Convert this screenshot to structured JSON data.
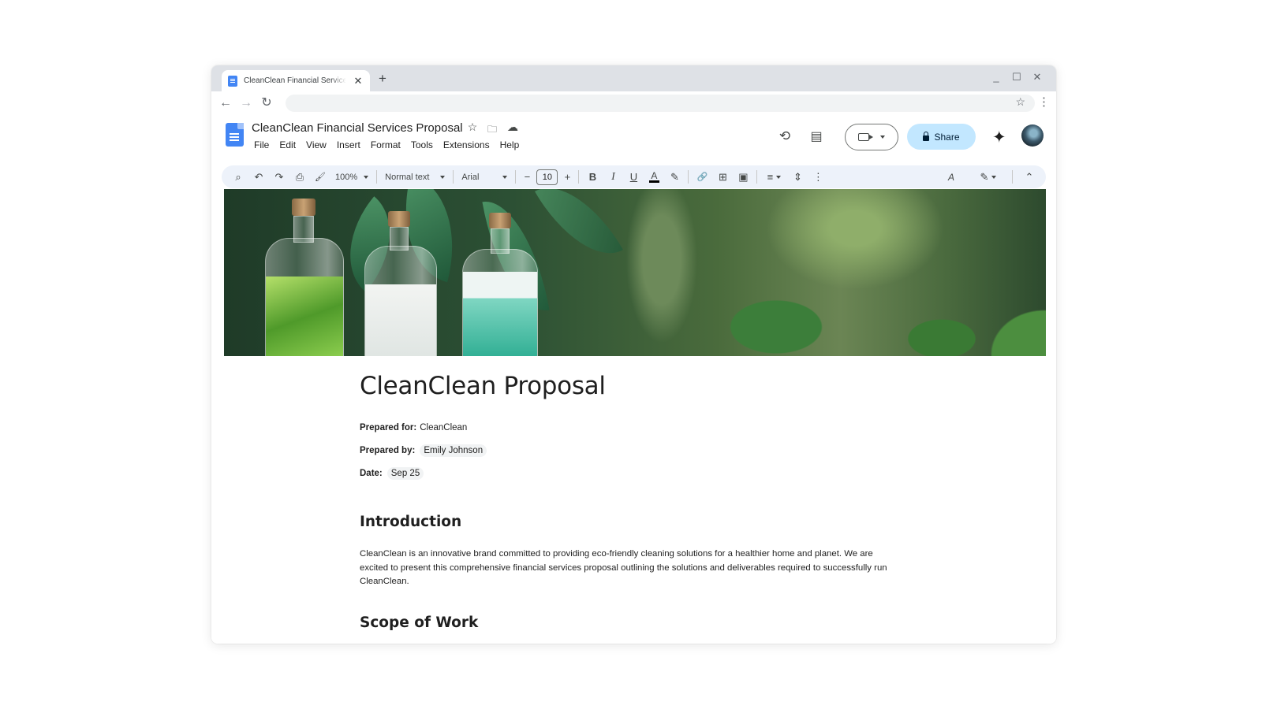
{
  "browser": {
    "tab_title": "CleanClean Financial Services Proposal",
    "tab_close": "✕",
    "new_tab": "+",
    "window_controls": {
      "minimize": "_",
      "maximize": "☐",
      "close": "✕"
    },
    "nav": {
      "back": "←",
      "forward": "→",
      "reload": "↻"
    },
    "bookmark_icon": "☆",
    "menu_icon": "⋮"
  },
  "docs": {
    "title": "CleanClean Financial Services Proposal",
    "title_icons": {
      "star": "☆",
      "move": "🗀",
      "cloud": "☁"
    },
    "menu": [
      "File",
      "Edit",
      "View",
      "Insert",
      "Format",
      "Tools",
      "Extensions",
      "Help"
    ],
    "header_icons": {
      "history": "⟲",
      "comments": "▤",
      "gemini": "✦"
    },
    "share_label": "Share",
    "brand_color": "#4285f4",
    "share_bg": "#c2e7ff"
  },
  "toolbar": {
    "search": "⌕",
    "undo": "↶",
    "redo": "↷",
    "print": "⎙",
    "paint_format": "🖌",
    "zoom": "100%",
    "style": "Normal text",
    "font": "Arial",
    "minus": "−",
    "font_size": "10",
    "plus": "+",
    "bold": "B",
    "italic": "I",
    "underline": "U",
    "text_color": "A",
    "highlight": "✎",
    "link": "🔗",
    "comment": "⊞",
    "image": "▣",
    "align": "≡",
    "line_spacing": "⇕",
    "more": "⋮",
    "spellcheck": "A",
    "editing": "✎",
    "collapse": "⌃"
  },
  "document": {
    "heading": "CleanClean Proposal",
    "prepared_for_label": "Prepared for:",
    "prepared_for_value": "CleanClean",
    "prepared_by_label": "Prepared by:",
    "prepared_by_value": "Emily Johnson",
    "date_label": "Date:",
    "date_value": "Sep 25",
    "intro_heading": "Introduction",
    "intro_text": "CleanClean is an innovative brand committed to providing eco-friendly cleaning solutions for a healthier home and planet. We are excited to present this comprehensive financial services proposal outlining the solutions and deliverables required to successfully run CleanClean.",
    "scope_heading": "Scope of Work"
  }
}
